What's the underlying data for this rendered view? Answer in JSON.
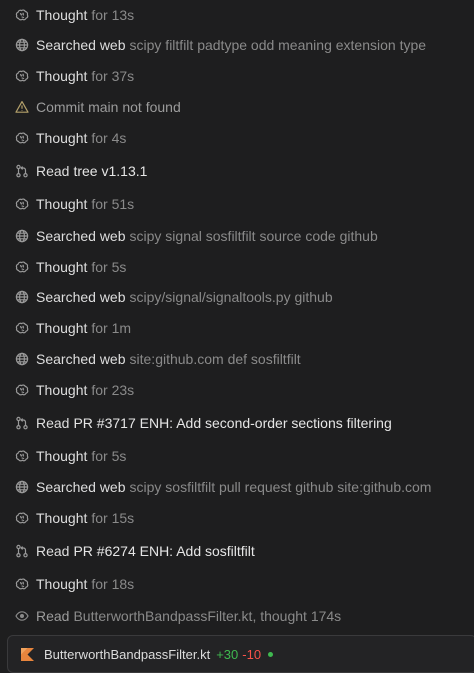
{
  "colors": {
    "background": "#1e1e1f",
    "added": "#3fb950",
    "removed": "#f85149",
    "kotlin_icon": "#e8853d"
  },
  "steps": [
    {
      "icon": "brain-icon",
      "label": "Thought",
      "detail": "for 13s"
    },
    {
      "icon": "globe-icon",
      "label": "Searched web",
      "detail": "scipy filtfilt padtype odd meaning extension type"
    },
    {
      "icon": "brain-icon",
      "label": "Thought",
      "detail": "for 37s"
    },
    {
      "icon": "warning-icon",
      "label": "Commit main not found",
      "detail": ""
    },
    {
      "icon": "brain-icon",
      "label": "Thought",
      "detail": "for 4s"
    },
    {
      "icon": "git-branch-icon",
      "label": "Read",
      "detail": "tree v1.13.1"
    },
    {
      "icon": "brain-icon",
      "label": "Thought",
      "detail": "for 51s"
    },
    {
      "icon": "globe-icon",
      "label": "Searched web",
      "detail": "scipy signal sosfiltfilt source code github"
    },
    {
      "icon": "brain-icon",
      "label": "Thought",
      "detail": "for 5s"
    },
    {
      "icon": "globe-icon",
      "label": "Searched web",
      "detail": "scipy/signal/signaltools.py github"
    },
    {
      "icon": "brain-icon",
      "label": "Thought",
      "detail": "for 1m"
    },
    {
      "icon": "globe-icon",
      "label": "Searched web",
      "detail": "site:github.com def sosfiltfilt"
    },
    {
      "icon": "brain-icon",
      "label": "Thought",
      "detail": "for 23s"
    },
    {
      "icon": "git-pr-icon",
      "label": "Read",
      "detail": "PR #3717 ENH: Add second-order sections filtering"
    },
    {
      "icon": "brain-icon",
      "label": "Thought",
      "detail": "for 5s"
    },
    {
      "icon": "globe-icon",
      "label": "Searched web",
      "detail": "scipy sosfiltfilt pull request github site:github.com"
    },
    {
      "icon": "brain-icon",
      "label": "Thought",
      "detail": "for 15s"
    },
    {
      "icon": "git-pr-icon",
      "label": "Read",
      "detail": "PR #6274 ENH: Add sosfiltfilt"
    },
    {
      "icon": "brain-icon",
      "label": "Thought",
      "detail": "for 18s"
    },
    {
      "icon": "eye-icon",
      "label": "Read",
      "detail": "ButterworthBandpassFilter.kt, thought 174s"
    }
  ],
  "file_change": {
    "icon": "kotlin-file-icon",
    "filename": "ButterworthBandpassFilter.kt",
    "added": "+30",
    "removed": "-10"
  }
}
